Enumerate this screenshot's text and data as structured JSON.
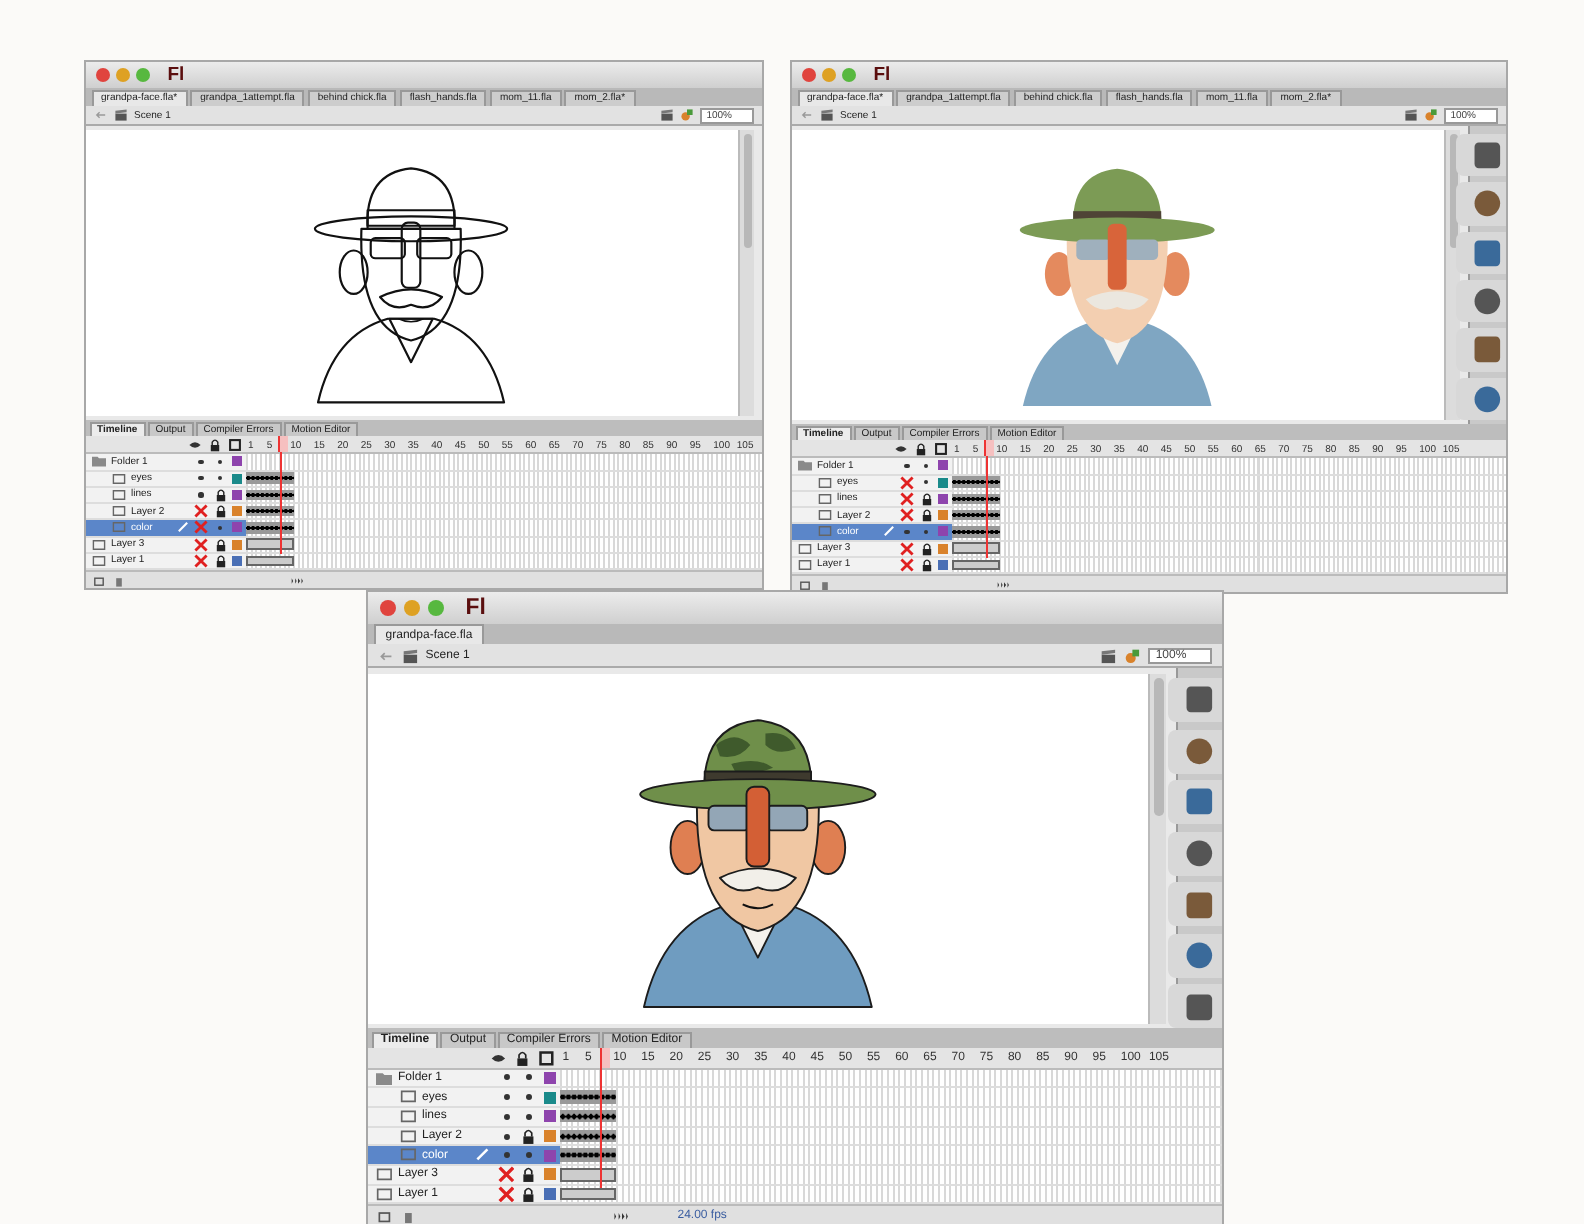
{
  "windows": [
    {
      "kind": "sketch",
      "logo": "Fl",
      "tools": false,
      "tabs": [
        {
          "label": "grandpa-face.fla*",
          "selected": true
        },
        {
          "label": "grandpa_1attempt.fla",
          "selected": false
        },
        {
          "label": "behind chick.fla",
          "selected": false
        },
        {
          "label": "flash_hands.fla",
          "selected": false
        },
        {
          "label": "mom_11.fla",
          "selected": false
        },
        {
          "label": "mom_2.fla*",
          "selected": false
        }
      ],
      "scene": "Scene 1",
      "zoom": "100%",
      "panel_tabs": [
        {
          "label": "Timeline",
          "selected": true
        },
        {
          "label": "Output",
          "selected": false
        },
        {
          "label": "Compiler Errors",
          "selected": false
        },
        {
          "label": "Motion Editor",
          "selected": false
        }
      ],
      "frame_numbers": [
        "1",
        "5",
        "10",
        "15",
        "20",
        "25",
        "30",
        "35",
        "40",
        "45",
        "50",
        "55",
        "60",
        "65",
        "70",
        "75",
        "80",
        "85",
        "90",
        "95",
        "100",
        "105"
      ],
      "layers": [
        {
          "name": "Folder 1",
          "kind": "folder",
          "hidden": false,
          "locked": false,
          "color": "#8e44ad",
          "selected": false,
          "children": [
            {
              "name": "eyes",
              "kind": "layer",
              "has_keyframes": true,
              "hidden": false,
              "locked": false,
              "color": "#1a8a8a",
              "selected": false
            },
            {
              "name": "lines",
              "kind": "layer",
              "has_keyframes": true,
              "hidden": false,
              "locked": true,
              "color": "#8e44ad",
              "selected": false
            },
            {
              "name": "Layer 2",
              "kind": "layer",
              "has_keyframes": true,
              "hidden": true,
              "locked": true,
              "color": "#d9822b",
              "selected": false
            },
            {
              "name": "color",
              "kind": "layer",
              "has_keyframes": true,
              "hidden": true,
              "locked": false,
              "color": "#8e44ad",
              "selected": true
            }
          ]
        },
        {
          "name": "Layer 3",
          "kind": "layer",
          "has_keyframes": false,
          "hidden": true,
          "locked": true,
          "color": "#d9822b",
          "selected": false
        },
        {
          "name": "Layer 1",
          "kind": "layer",
          "has_keyframes": false,
          "hidden": true,
          "locked": true,
          "color": "#4a6fb5",
          "selected": false
        }
      ]
    },
    {
      "kind": "flat",
      "logo": "Fl",
      "tools": true,
      "tabs": [
        {
          "label": "grandpa-face.fla*",
          "selected": true
        },
        {
          "label": "grandpa_1attempt.fla",
          "selected": false
        },
        {
          "label": "behind chick.fla",
          "selected": false
        },
        {
          "label": "flash_hands.fla",
          "selected": false
        },
        {
          "label": "mom_11.fla",
          "selected": false
        },
        {
          "label": "mom_2.fla*",
          "selected": false
        }
      ],
      "scene": "Scene 1",
      "zoom": "100%",
      "panel_tabs": [
        {
          "label": "Timeline",
          "selected": true
        },
        {
          "label": "Output",
          "selected": false
        },
        {
          "label": "Compiler Errors",
          "selected": false
        },
        {
          "label": "Motion Editor",
          "selected": false
        }
      ],
      "frame_numbers": [
        "1",
        "5",
        "10",
        "15",
        "20",
        "25",
        "30",
        "35",
        "40",
        "45",
        "50",
        "55",
        "60",
        "65",
        "70",
        "75",
        "80",
        "85",
        "90",
        "95",
        "100",
        "105"
      ],
      "layers": [
        {
          "name": "Folder 1",
          "kind": "folder",
          "hidden": false,
          "locked": false,
          "color": "#8e44ad",
          "selected": false,
          "children": [
            {
              "name": "eyes",
              "kind": "layer",
              "has_keyframes": true,
              "hidden": true,
              "locked": false,
              "color": "#1a8a8a",
              "selected": false
            },
            {
              "name": "lines",
              "kind": "layer",
              "has_keyframes": true,
              "hidden": true,
              "locked": true,
              "color": "#8e44ad",
              "selected": false
            },
            {
              "name": "Layer 2",
              "kind": "layer",
              "has_keyframes": true,
              "hidden": true,
              "locked": true,
              "color": "#d9822b",
              "selected": false
            },
            {
              "name": "color",
              "kind": "layer",
              "has_keyframes": true,
              "hidden": false,
              "locked": false,
              "color": "#8e44ad",
              "selected": true
            }
          ]
        },
        {
          "name": "Layer 3",
          "kind": "layer",
          "has_keyframes": false,
          "hidden": true,
          "locked": true,
          "color": "#d9822b",
          "selected": false
        },
        {
          "name": "Layer 1",
          "kind": "layer",
          "has_keyframes": false,
          "hidden": true,
          "locked": true,
          "color": "#4a6fb5",
          "selected": false
        }
      ]
    },
    {
      "kind": "shaded",
      "logo": "Fl",
      "tools": true,
      "tabs": [
        {
          "label": "grandpa-face.fla",
          "selected": true
        }
      ],
      "scene": "Scene 1",
      "zoom": "100%",
      "panel_tabs": [
        {
          "label": "Timeline",
          "selected": true
        },
        {
          "label": "Output",
          "selected": false
        },
        {
          "label": "Compiler Errors",
          "selected": false
        },
        {
          "label": "Motion Editor",
          "selected": false
        }
      ],
      "frame_numbers": [
        "1",
        "5",
        "10",
        "15",
        "20",
        "25",
        "30",
        "35",
        "40",
        "45",
        "50",
        "55",
        "60",
        "65",
        "70",
        "75",
        "80",
        "85",
        "90",
        "95",
        "100",
        "105"
      ],
      "layers": [
        {
          "name": "Folder 1",
          "kind": "folder",
          "hidden": false,
          "locked": false,
          "color": "#8e44ad",
          "selected": false,
          "children": [
            {
              "name": "eyes",
              "kind": "layer",
              "has_keyframes": true,
              "hidden": false,
              "locked": false,
              "color": "#1a8a8a",
              "selected": false
            },
            {
              "name": "lines",
              "kind": "layer",
              "has_keyframes": true,
              "hidden": false,
              "locked": false,
              "color": "#8e44ad",
              "selected": false
            },
            {
              "name": "Layer 2",
              "kind": "layer",
              "has_keyframes": true,
              "hidden": false,
              "locked": true,
              "color": "#d9822b",
              "selected": false
            },
            {
              "name": "color",
              "kind": "layer",
              "has_keyframes": true,
              "hidden": false,
              "locked": false,
              "color": "#8e44ad",
              "selected": true
            }
          ]
        },
        {
          "name": "Layer 3",
          "kind": "layer",
          "has_keyframes": false,
          "hidden": true,
          "locked": true,
          "color": "#d9822b",
          "selected": false
        },
        {
          "name": "Layer 1",
          "kind": "layer",
          "has_keyframes": false,
          "hidden": true,
          "locked": true,
          "color": "#4a6fb5",
          "selected": false
        }
      ],
      "fps": "24.00 fps"
    }
  ]
}
